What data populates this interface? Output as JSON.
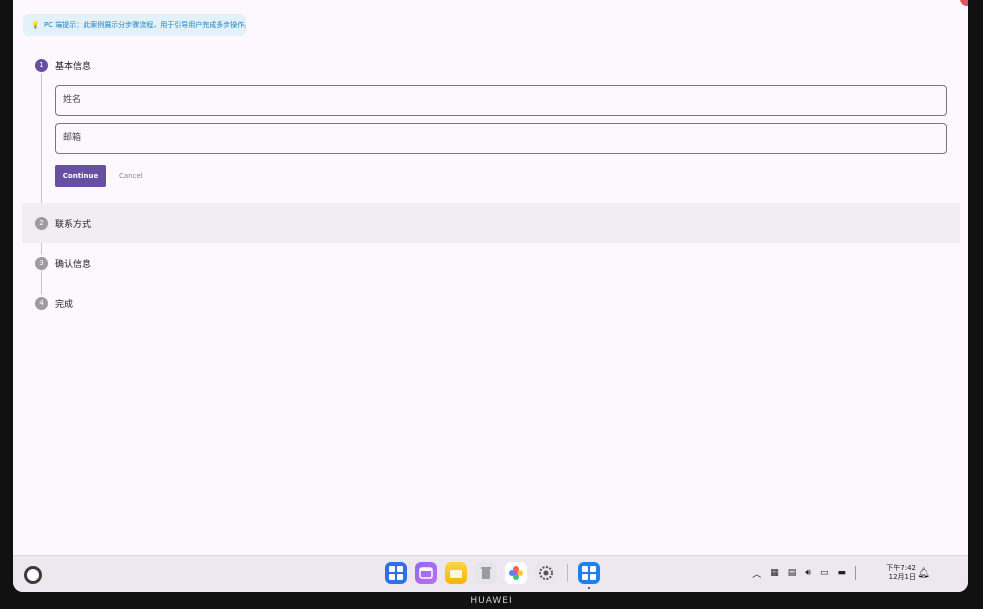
{
  "tip": {
    "bulb": "💡",
    "text": "PC 端提示：此案例展示分步骤流程，用于引导用户完成多步操作。"
  },
  "steps": [
    {
      "number": "1",
      "title": "基本信息",
      "active": true
    },
    {
      "number": "2",
      "title": "联系方式",
      "active": false
    },
    {
      "number": "3",
      "title": "确认信息",
      "active": false
    },
    {
      "number": "4",
      "title": "完成",
      "active": false
    }
  ],
  "form": {
    "name_placeholder": "姓名",
    "email_placeholder": "邮箱",
    "continue_label": "Continue",
    "cancel_label": "Cancel"
  },
  "taskbar": {
    "clock_time": "下午7:42",
    "clock_date": "12月1日",
    "tray_icons": [
      "chevron-up-icon",
      "keyboard-icon",
      "clipboard-icon",
      "volume-icon",
      "display-icon",
      "battery-icon"
    ]
  },
  "brand": "HUAWEI",
  "colors": {
    "accent": "#6750a4",
    "tip_bg": "#e3f1fb",
    "tip_text": "#1d7fc8"
  }
}
